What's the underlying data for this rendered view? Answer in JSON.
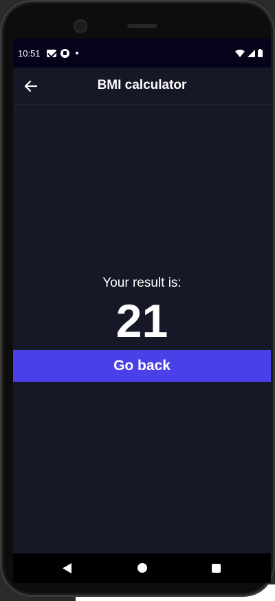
{
  "status_bar": {
    "time": "10:51",
    "icons": [
      "gmail-icon",
      "app-icon",
      "dot-icon",
      "wifi-icon",
      "signal-icon",
      "battery-icon"
    ]
  },
  "app_bar": {
    "title": "BMI calculator",
    "back_icon": "arrow-left-icon"
  },
  "result": {
    "label": "Your result is:",
    "value": "21"
  },
  "actions": {
    "go_back_label": "Go back"
  },
  "nav_bar": {
    "icons": [
      "nav-back-icon",
      "nav-home-icon",
      "nav-recents-icon"
    ]
  },
  "colors": {
    "background": "#161827",
    "status_bar": "#05031a",
    "accent": "#4a40e8",
    "text": "#ffffff"
  }
}
